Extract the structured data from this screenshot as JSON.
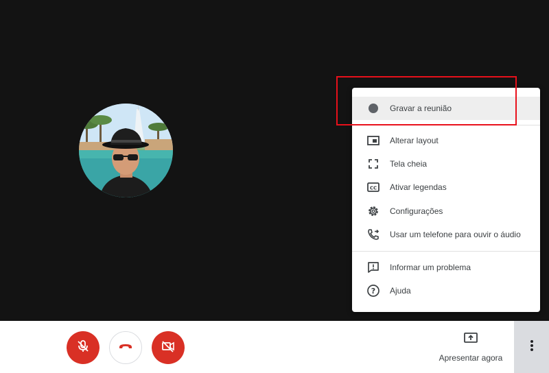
{
  "menu": {
    "items": [
      {
        "label": "Gravar a reunião",
        "icon": "record-dot-icon"
      },
      {
        "label": "Alterar layout",
        "icon": "layout-icon"
      },
      {
        "label": "Tela cheia",
        "icon": "fullscreen-icon"
      },
      {
        "label": "Ativar legendas",
        "icon": "closed-captions-icon"
      },
      {
        "label": "Configurações",
        "icon": "gear-icon"
      },
      {
        "label": "Usar um telefone para ouvir o áudio",
        "icon": "phone-forward-icon"
      },
      {
        "label": "Informar um problema",
        "icon": "feedback-icon"
      },
      {
        "label": "Ajuda",
        "icon": "help-icon"
      }
    ]
  },
  "controls": {
    "mic": {
      "icon": "mic-off-icon",
      "color": "#d93025"
    },
    "hangup": {
      "icon": "hangup-icon",
      "color": "#d93025"
    },
    "camera": {
      "icon": "camera-off-icon",
      "color": "#d93025"
    },
    "present": {
      "label": "Apresentar agora",
      "icon": "present-screen-icon"
    },
    "more": {
      "icon": "more-vert-icon"
    }
  },
  "colors": {
    "stage_bg": "#131313",
    "accent_red": "#d93025",
    "highlight": "#e8101b"
  }
}
